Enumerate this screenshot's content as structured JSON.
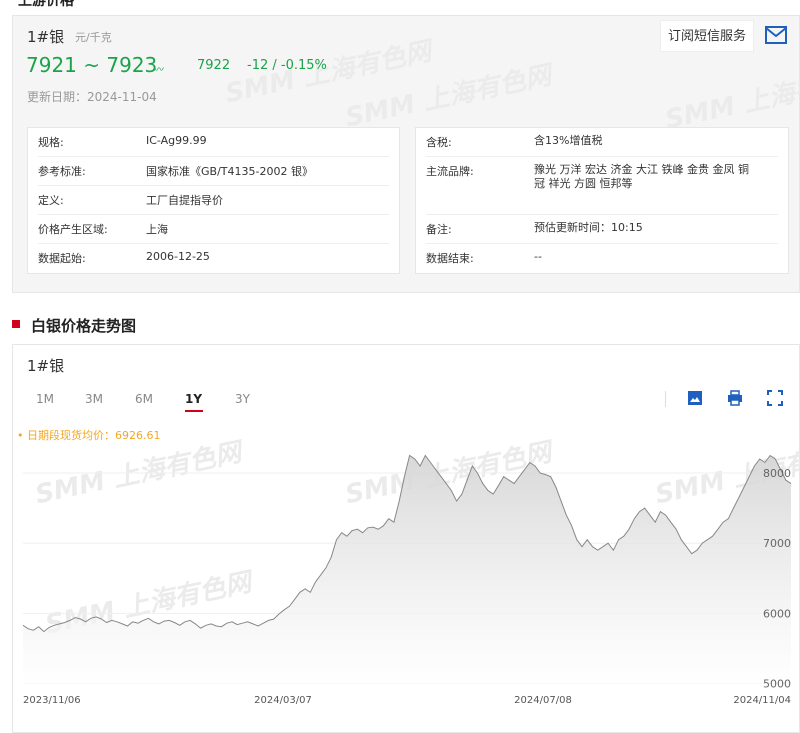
{
  "section_top": "上游价格",
  "product": {
    "name": "1#银",
    "unit": "元/千克",
    "price_range": "7921 ~ 7923",
    "avg": "7922",
    "change": "-12 / -0.15%",
    "update_date": "更新日期：2024-11-04",
    "subscribe_label": "订阅短信服务"
  },
  "info_left": [
    {
      "k": "规格:",
      "v": "IC-Ag99.99"
    },
    {
      "k": "参考标准:",
      "v": "国家标准《GB/T4135-2002 银》"
    },
    {
      "k": "定义:",
      "v": "工厂自提指导价"
    },
    {
      "k": "价格产生区域:",
      "v": "上海"
    },
    {
      "k": "数据起始:",
      "v": "2006-12-25"
    }
  ],
  "info_right": [
    {
      "k": "含税:",
      "v": "含13%增值税"
    },
    {
      "k": "主流品牌:",
      "v": "豫光 万洋 宏达 济金 大江 铁峰 金贵 金凤 铜冠 祥光 方圆 恒邦等"
    },
    {
      "k": "备注:",
      "v": "预估更新时间：10:15"
    },
    {
      "k": "数据结束:",
      "v": "--"
    }
  ],
  "watermark": "SMM 上海有色网",
  "section_title": "白银价格走势图",
  "chart_panel": {
    "title": "1#银",
    "tabs": [
      "1M",
      "3M",
      "6M",
      "1Y",
      "3Y"
    ],
    "active_tab": "1Y",
    "avg_label": "• 日期段现货均价：6926.61"
  },
  "colors": {
    "up_down": "#1aa34a",
    "accent": "#d0021b",
    "avg_label": "#f5a623"
  },
  "chart_data": {
    "type": "area",
    "title": "",
    "xlabel": "",
    "ylabel": "",
    "ylim": [
      4950,
      8400
    ],
    "yticks": [
      5000,
      6000,
      7000,
      8000
    ],
    "xticks": [
      "2023/11/06",
      "2024/03/07",
      "2024/07/08",
      "2024/11/04"
    ],
    "x_start": "2023/11/06",
    "x_end": "2024/11/04",
    "series": [
      {
        "values": [
          5830,
          5780,
          5760,
          5810,
          5740,
          5800,
          5830,
          5850,
          5870,
          5900,
          5940,
          5920,
          5880,
          5930,
          5950,
          5920,
          5870,
          5900,
          5880,
          5850,
          5820,
          5880,
          5860,
          5900,
          5930,
          5880,
          5850,
          5890,
          5900,
          5870,
          5830,
          5880,
          5900,
          5850,
          5790,
          5830,
          5850,
          5820,
          5810,
          5860,
          5880,
          5840,
          5860,
          5880,
          5850,
          5820,
          5860,
          5900,
          5920,
          5990,
          6050,
          6100,
          6200,
          6300,
          6350,
          6300,
          6450,
          6550,
          6650,
          6800,
          7050,
          7150,
          7100,
          7180,
          7200,
          7150,
          7220,
          7230,
          7200,
          7250,
          7350,
          7300,
          7600,
          7950,
          8250,
          8200,
          8100,
          8250,
          8150,
          8050,
          7950,
          7850,
          7750,
          7600,
          7700,
          7900,
          8100,
          8000,
          7850,
          7750,
          7700,
          7820,
          7950,
          7900,
          7850,
          7950,
          8050,
          8150,
          8100,
          8000,
          7980,
          7950,
          7800,
          7600,
          7400,
          7250,
          7050,
          6950,
          7050,
          6950,
          6900,
          6950,
          7000,
          6900,
          7050,
          7100,
          7200,
          7350,
          7450,
          7500,
          7400,
          7300,
          7450,
          7400,
          7300,
          7200,
          7050,
          6950,
          6850,
          6900,
          7000,
          7050,
          7100,
          7200,
          7300,
          7350,
          7500,
          7650,
          7800,
          7950,
          8100,
          8200,
          8150,
          8250,
          8200,
          8050,
          7900,
          7850
        ]
      }
    ]
  }
}
